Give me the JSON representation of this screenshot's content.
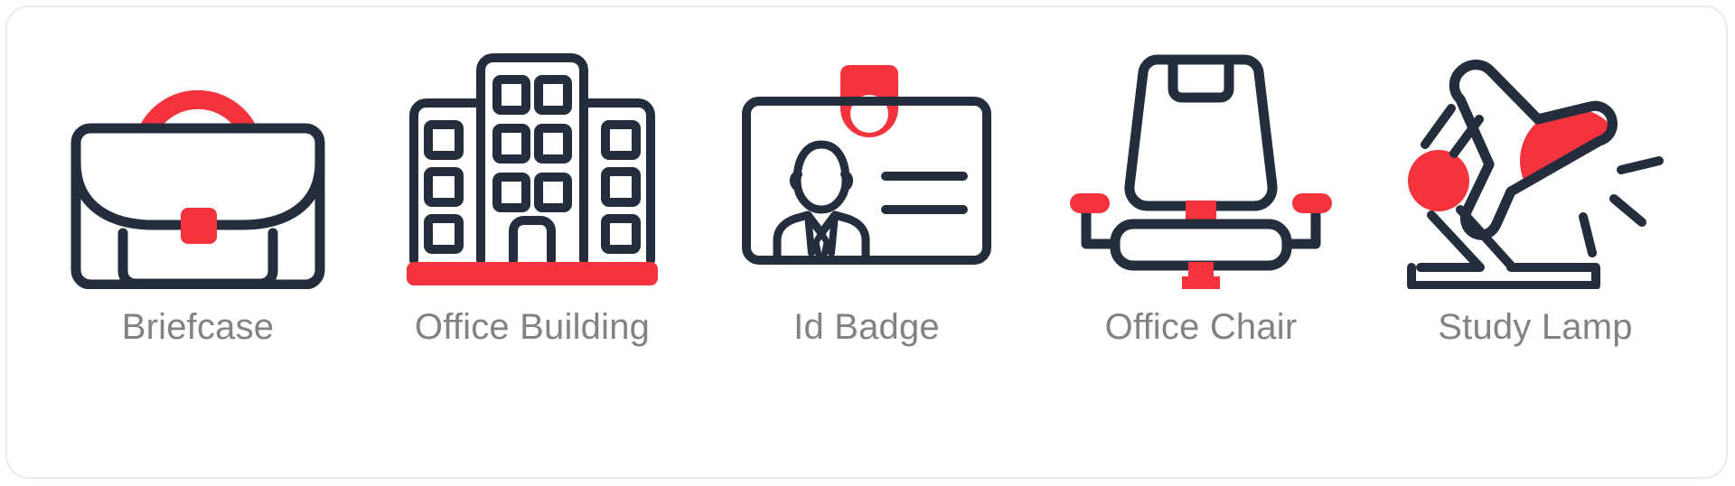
{
  "page": {
    "background_color": "#ffffff",
    "frame_border_color": "#e9ebee",
    "label_color": "#808285"
  },
  "palette": {
    "dark": "#232d3b",
    "red": "#f5333f",
    "white": "#ffffff"
  },
  "icons": [
    {
      "id": "briefcase",
      "label": "Briefcase",
      "icon_name": "briefcase-icon",
      "parts": [
        "red-handle-arc",
        "dark-case-body",
        "flap-curve",
        "red-square-latch",
        "inner-pocket"
      ]
    },
    {
      "id": "office-building",
      "label": "Office Building",
      "icon_name": "office-building-icon",
      "parts": [
        "center-tower",
        "left-wing",
        "right-wing",
        "window-grid",
        "entrance-door",
        "red-ground-bar"
      ]
    },
    {
      "id": "id-badge",
      "label": "Id Badge",
      "icon_name": "id-badge-icon",
      "parts": [
        "red-clip-with-hole",
        "card-outline",
        "person-portrait",
        "text-line-1",
        "text-line-2"
      ]
    },
    {
      "id": "office-chair",
      "label": "Office Chair",
      "icon_name": "office-chair-icon",
      "parts": [
        "backrest",
        "headrest-notch",
        "red-armrest-caps",
        "armrest-frame",
        "seat",
        "red-post",
        "wheel-base-arc",
        "red-wheels"
      ]
    },
    {
      "id": "study-lamp",
      "label": "Study Lamp",
      "icon_name": "study-lamp-icon",
      "parts": [
        "lamp-shade",
        "red-light-semicircle",
        "light-rays",
        "red-joint-circle",
        "arm-bars",
        "base-bar"
      ]
    }
  ]
}
